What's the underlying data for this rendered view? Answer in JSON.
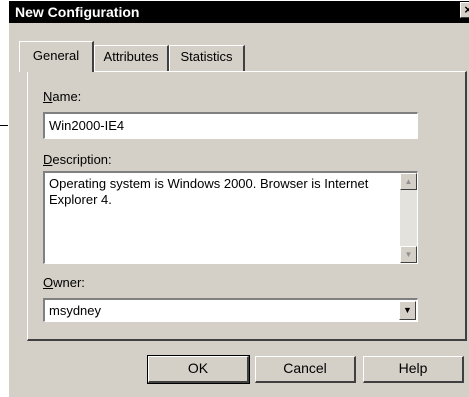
{
  "window": {
    "title": "New Configuration",
    "close_glyph": "×"
  },
  "tabs": [
    {
      "label": "General",
      "active": true
    },
    {
      "label": "Attributes",
      "active": false
    },
    {
      "label": "Statistics",
      "active": false
    }
  ],
  "form": {
    "name_label_mnemonic": "N",
    "name_label_rest": "ame:",
    "name_value": "Win2000-IE4",
    "description_label_mnemonic": "D",
    "description_label_rest": "escription:",
    "description_value": "Operating system is Windows 2000. Browser is Internet Explorer 4.",
    "owner_label_mnemonic": "O",
    "owner_label_rest": "wner:",
    "owner_value": "msydney"
  },
  "icons": {
    "scroll_up": "▲",
    "scroll_down": "▼",
    "dropdown": "▼"
  },
  "buttons": {
    "ok": "OK",
    "cancel": "Cancel",
    "help": "Help"
  }
}
